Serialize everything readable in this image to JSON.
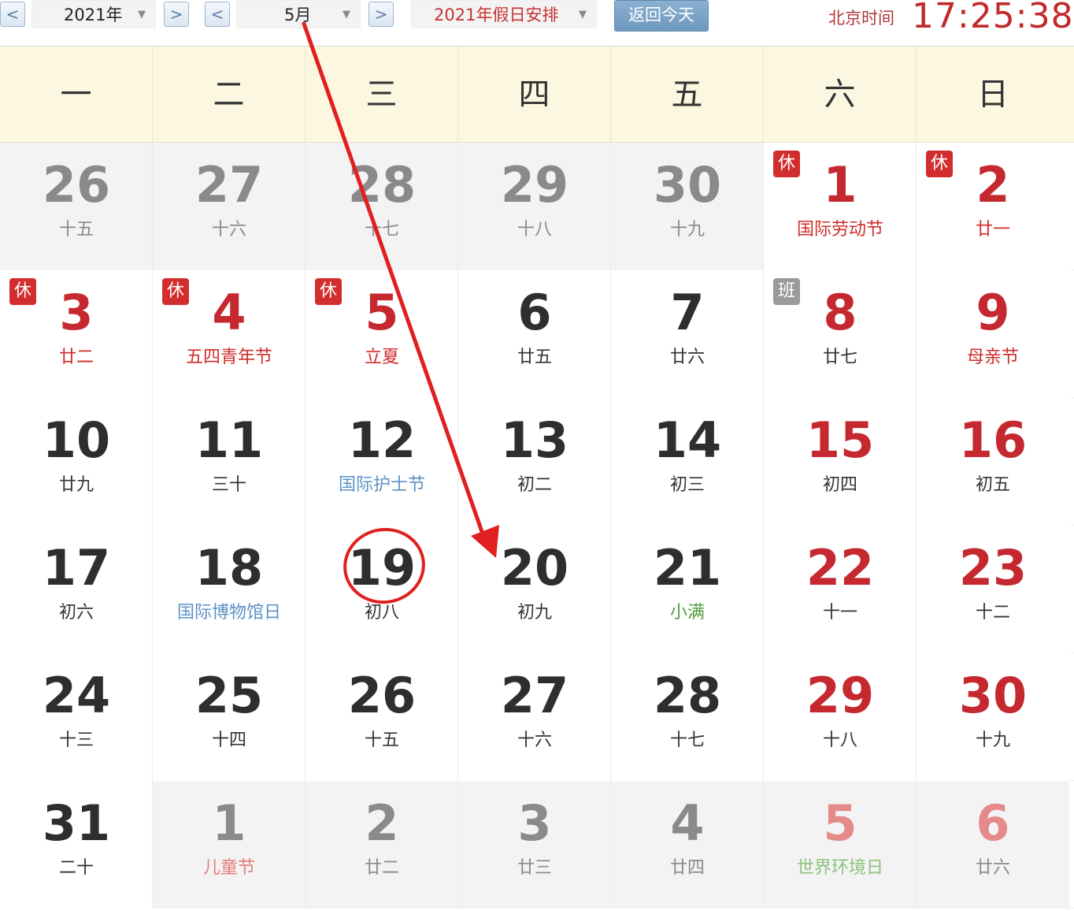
{
  "toolbar": {
    "prev_year_icon": "chevron-left-icon",
    "year_value": "2021年",
    "next_year_icon": "chevron-right-icon",
    "prev_month_icon": "chevron-left-icon",
    "month_value": "5月",
    "next_month_icon": "chevron-right-icon",
    "holiday_select_label": "2021年假日安排",
    "today_button": "返回今天",
    "clock_label": "北京时间",
    "clock_time": "17:25:38",
    "arrow_left": "<",
    "arrow_right": ">",
    "caret": "▼"
  },
  "colors": {
    "holiday_red": "#d02b2b",
    "festival_blue": "#5b92c6",
    "solar_term_green": "#4f9a3c",
    "header_bg": "#fcf7e0",
    "annotation_red": "#e02020"
  },
  "weekdays": [
    "一",
    "二",
    "三",
    "四",
    "五",
    "六",
    "日"
  ],
  "weeks": [
    [
      {
        "day": "26",
        "lunar": "十五",
        "other": true
      },
      {
        "day": "27",
        "lunar": "十六",
        "other": true
      },
      {
        "day": "28",
        "lunar": "十七",
        "other": true
      },
      {
        "day": "29",
        "lunar": "十八",
        "other": true
      },
      {
        "day": "30",
        "lunar": "十九",
        "other": true
      },
      {
        "day": "1",
        "lunar": "国际劳动节",
        "color": "red",
        "badge": "休"
      },
      {
        "day": "2",
        "lunar": "廿一",
        "color": "red",
        "badge": "休"
      }
    ],
    [
      {
        "day": "3",
        "lunar": "廿二",
        "color": "red",
        "badge": "休"
      },
      {
        "day": "4",
        "lunar": "五四青年节",
        "color": "red",
        "badge": "休"
      },
      {
        "day": "5",
        "lunar": "立夏",
        "color": "red",
        "badge": "休"
      },
      {
        "day": "6",
        "lunar": "廿五"
      },
      {
        "day": "7",
        "lunar": "廿六"
      },
      {
        "day": "8",
        "lunar": "廿七",
        "badge": "班"
      },
      {
        "day": "9",
        "lunar": "母亲节",
        "color": "red"
      }
    ],
    [
      {
        "day": "10",
        "lunar": "廿九"
      },
      {
        "day": "11",
        "lunar": "三十"
      },
      {
        "day": "12",
        "lunar": "国际护士节",
        "color": "blue"
      },
      {
        "day": "13",
        "lunar": "初二"
      },
      {
        "day": "14",
        "lunar": "初三"
      },
      {
        "day": "15",
        "lunar": "初四"
      },
      {
        "day": "16",
        "lunar": "初五"
      }
    ],
    [
      {
        "day": "17",
        "lunar": "初六"
      },
      {
        "day": "18",
        "lunar": "国际博物馆日",
        "color": "blue"
      },
      {
        "day": "19",
        "lunar": "初八",
        "circled": true
      },
      {
        "day": "20",
        "lunar": "初九"
      },
      {
        "day": "21",
        "lunar": "小满",
        "color": "green"
      },
      {
        "day": "22",
        "lunar": "十一"
      },
      {
        "day": "23",
        "lunar": "十二"
      }
    ],
    [
      {
        "day": "24",
        "lunar": "十三"
      },
      {
        "day": "25",
        "lunar": "十四"
      },
      {
        "day": "26",
        "lunar": "十五"
      },
      {
        "day": "27",
        "lunar": "十六"
      },
      {
        "day": "28",
        "lunar": "十七"
      },
      {
        "day": "29",
        "lunar": "十八"
      },
      {
        "day": "30",
        "lunar": "十九"
      }
    ],
    [
      {
        "day": "31",
        "lunar": "二十"
      },
      {
        "day": "1",
        "lunar": "儿童节",
        "color": "red",
        "other": true
      },
      {
        "day": "2",
        "lunar": "廿二",
        "other": true
      },
      {
        "day": "3",
        "lunar": "廿三",
        "other": true
      },
      {
        "day": "4",
        "lunar": "廿四",
        "other": true
      },
      {
        "day": "5",
        "lunar": "世界环境日",
        "color": "green",
        "other": true
      },
      {
        "day": "6",
        "lunar": "廿六",
        "other": true
      }
    ]
  ]
}
